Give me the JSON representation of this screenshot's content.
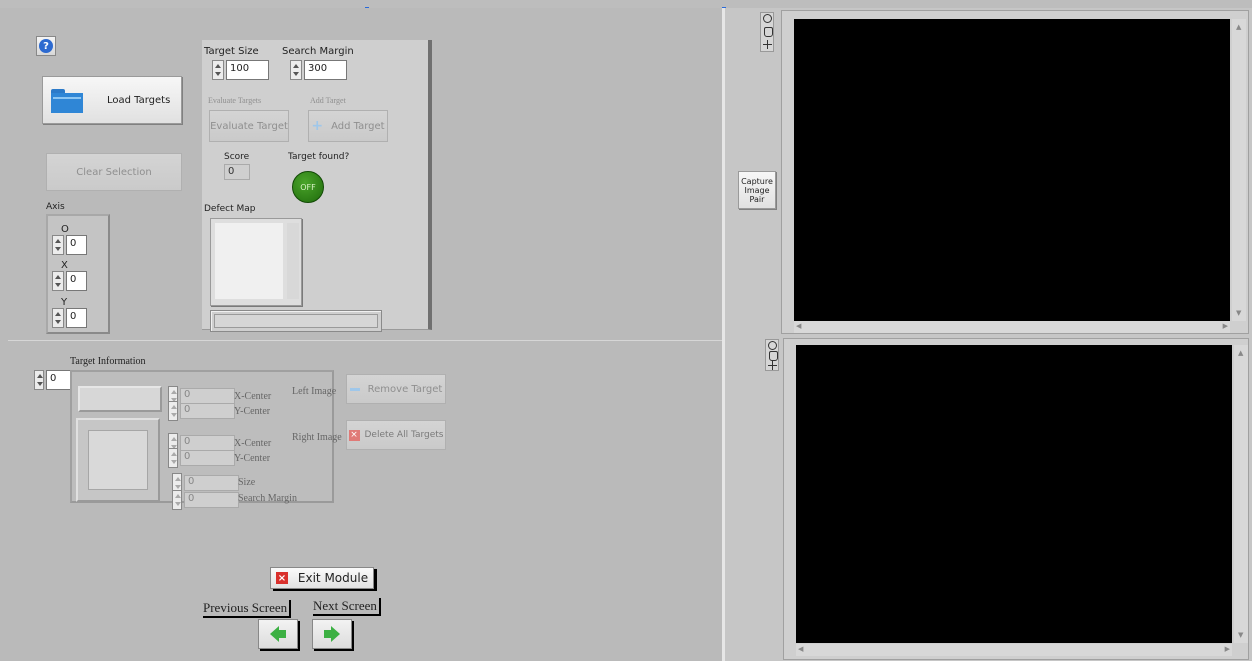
{
  "help": {
    "icon": "help-question-icon"
  },
  "load_targets": {
    "label": "Load Targets",
    "icon": "folder-icon"
  },
  "clear_selection": {
    "label": "Clear Selection"
  },
  "axis": {
    "title": "Axis",
    "o_label": "O",
    "o_value": "0",
    "x_label": "X",
    "x_value": "0",
    "y_label": "Y",
    "y_value": "0"
  },
  "target_panel": {
    "target_size_label": "Target Size",
    "target_size_value": "100",
    "search_margin_label": "Search Margin",
    "search_margin_value": "300",
    "evaluate_caption": "Evaluate Targets",
    "evaluate_button": "Evaluate Target",
    "add_caption": "Add Target",
    "add_button": "Add Target",
    "score_label": "Score",
    "score_value": "0",
    "found_label": "Target found?",
    "found_led": "OFF",
    "defect_map_label": "Defect Map"
  },
  "target_info": {
    "title": "Target Information",
    "index": "0",
    "left_image_label": "Left Image",
    "right_image_label": "Right Image",
    "left_x": "0",
    "left_x_label": "X-Center",
    "left_y": "0",
    "left_y_label": "Y-Center",
    "right_x": "0",
    "right_x_label": "X-Center",
    "right_y": "0",
    "right_y_label": "Y-Center",
    "size": "0",
    "size_label": "Size",
    "search_margin": "0",
    "search_margin_label": "Search Margin"
  },
  "remove_target": {
    "label": "Remove Target"
  },
  "delete_all": {
    "label": "Delete All Targets"
  },
  "exit_module": {
    "label": "Exit Module"
  },
  "nav": {
    "prev_label": "Previous Screen",
    "next_label": "Next Screen"
  },
  "capture": {
    "label_line1": "Capture",
    "label_line2": "Image",
    "label_line3": "Pair"
  },
  "colors": {
    "led_off": "#2d7a14",
    "display_bg": "#000000",
    "pane_bg": "#bababa",
    "accent_handle": "#2a6ad8",
    "exit_red": "#d9302c",
    "arrow_green": "#3cb043"
  }
}
